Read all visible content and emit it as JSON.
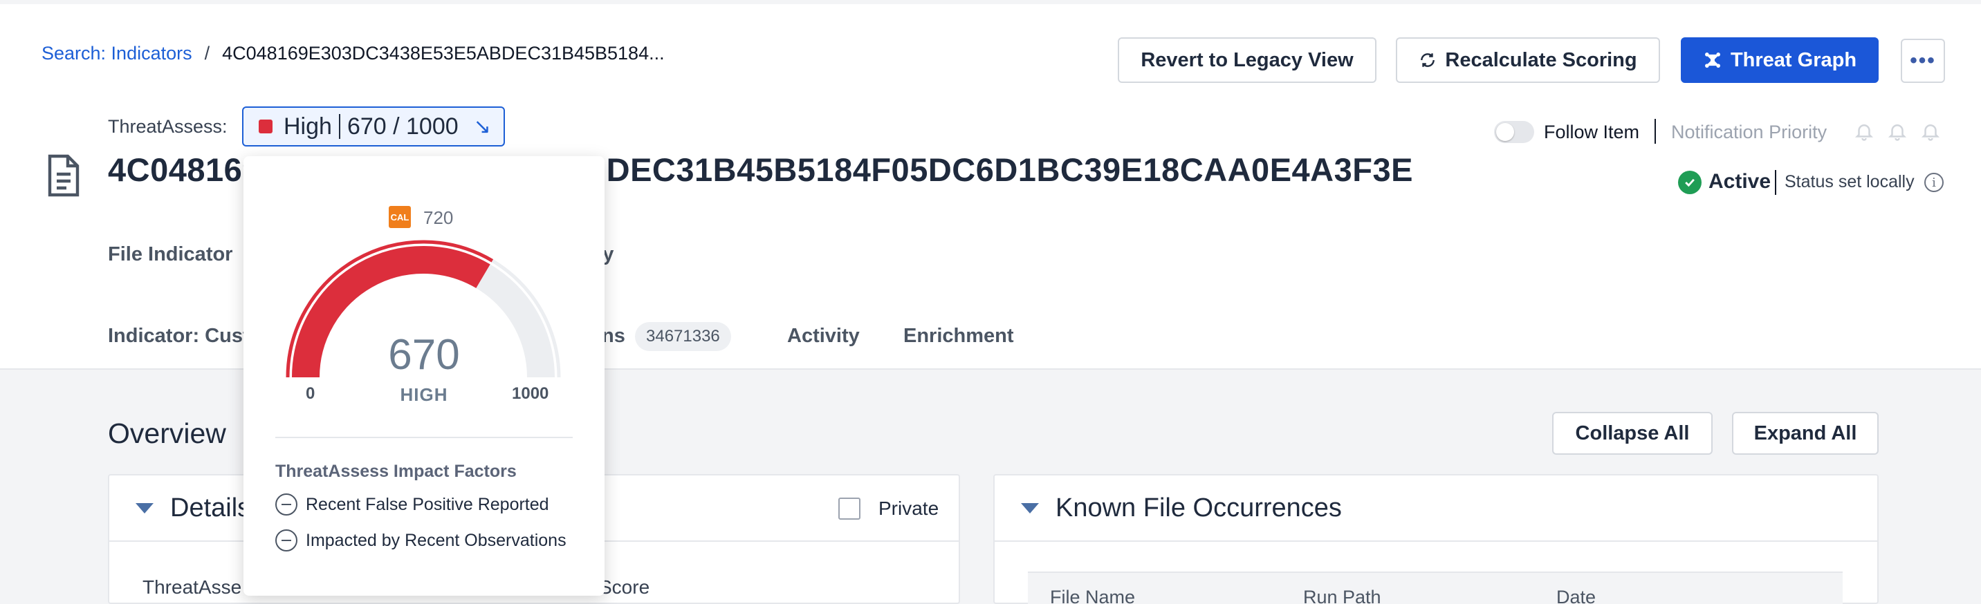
{
  "breadcrumb": {
    "link": "Search: Indicators",
    "separator": "/",
    "current": "4C048169E303DC3438E53E5ABDEC31B45B5184..."
  },
  "toolbar": {
    "revert_label": "Revert to Legacy View",
    "recalc_label": "Recalculate Scoring",
    "threat_graph_label": "Threat Graph",
    "more_label": "•••"
  },
  "threat_assess": {
    "label": "ThreatAssess:",
    "level": "High",
    "score": "670 / 1000"
  },
  "indicator": {
    "title": "4C048169E303DC3438E53E5ABDEC31B45B5184F05DC6D1BC39E18CAA0E4A3F3E",
    "type": "File Indicator",
    "meta_tail": "ry"
  },
  "follow": {
    "label": "Follow Item",
    "notification_label": "Notification Priority"
  },
  "status": {
    "active": "Active",
    "note": "Status set locally"
  },
  "tabs": {
    "indicator": "Indicator: Cust",
    "observations_tail": "ns",
    "observations_count": "34671336",
    "activity": "Activity",
    "enrichment": "Enrichment"
  },
  "overview": {
    "title": "Overview",
    "collapse_all": "Collapse All",
    "expand_all": "Expand All"
  },
  "details_panel": {
    "title": "Details",
    "private_label": "Private",
    "field_left": "ThreatAsse",
    "field_right": "Score"
  },
  "occurrences_panel": {
    "title": "Known File Occurrences",
    "columns": [
      "File Name",
      "Run Path",
      "Date"
    ]
  },
  "popover": {
    "cal_badge": "CAL",
    "cal_score": "720",
    "gauge_value": "670",
    "gauge_level": "HIGH",
    "gauge_min": "0",
    "gauge_max": "1000",
    "gauge_fraction": 0.67,
    "impact_title": "ThreatAssess Impact Factors",
    "impact_factors": [
      "Recent False Positive Reported",
      "Impacted by Recent Observations"
    ]
  },
  "colors": {
    "brand_blue": "#1b57d8",
    "high_red": "#dc2e3c",
    "active_green": "#1f9d55",
    "cal_orange": "#f07e1b"
  }
}
